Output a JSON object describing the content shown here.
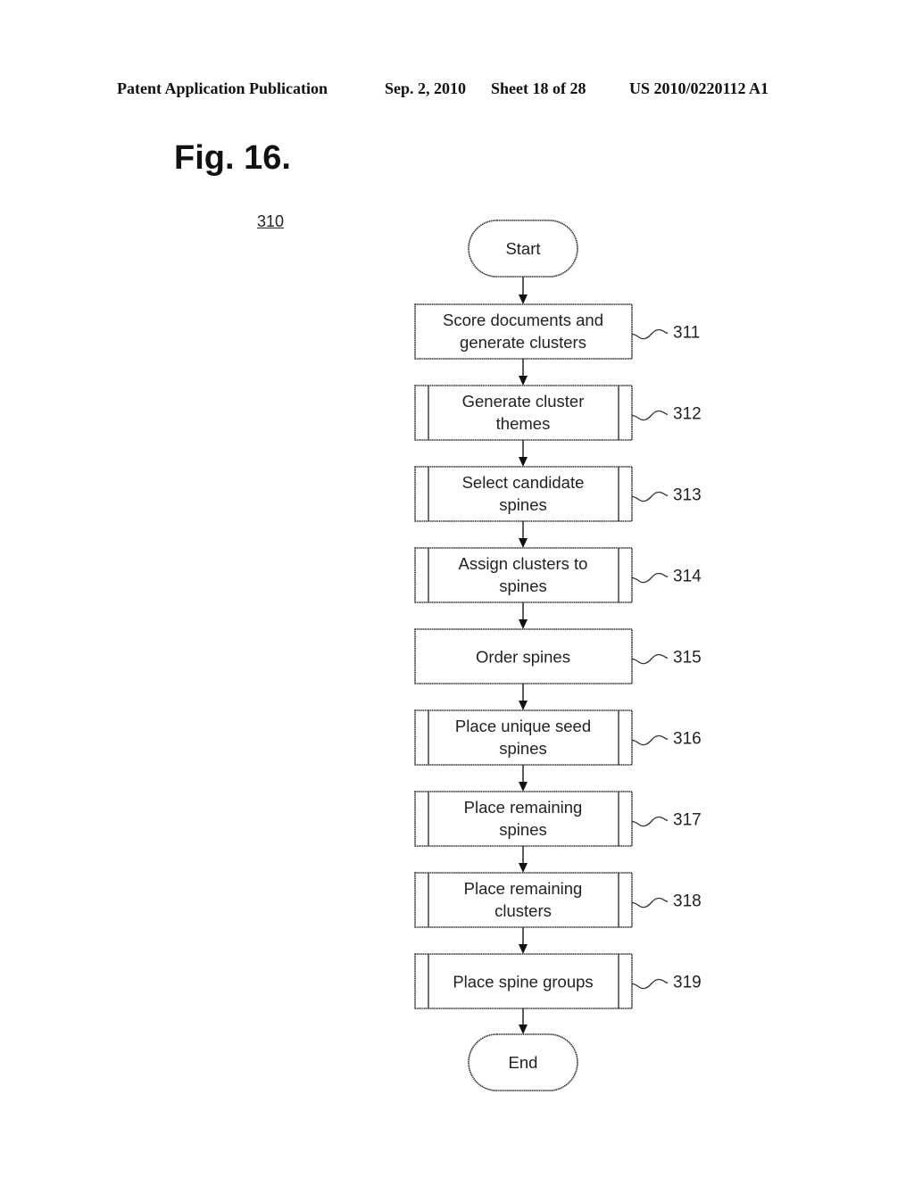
{
  "header": {
    "publication": "Patent Application Publication",
    "date": "Sep. 2, 2010",
    "sheet": "Sheet 18 of 28",
    "number": "US 2010/0220112 A1"
  },
  "figure": {
    "title": "Fig. 16.",
    "reference": "310"
  },
  "flowchart": {
    "start": "Start",
    "end": "End",
    "steps": [
      {
        "ref": "311",
        "lines": [
          "Score documents and",
          "generate clusters"
        ],
        "type": "process"
      },
      {
        "ref": "312",
        "lines": [
          "Generate cluster",
          "themes"
        ],
        "type": "predefined"
      },
      {
        "ref": "313",
        "lines": [
          "Select candidate",
          "spines"
        ],
        "type": "predefined"
      },
      {
        "ref": "314",
        "lines": [
          "Assign clusters to",
          "spines"
        ],
        "type": "predefined"
      },
      {
        "ref": "315",
        "lines": [
          "Order spines"
        ],
        "type": "process"
      },
      {
        "ref": "316",
        "lines": [
          "Place unique seed",
          "spines"
        ],
        "type": "predefined"
      },
      {
        "ref": "317",
        "lines": [
          "Place remaining",
          "spines"
        ],
        "type": "predefined"
      },
      {
        "ref": "318",
        "lines": [
          "Place remaining",
          "clusters"
        ],
        "type": "predefined"
      },
      {
        "ref": "319",
        "lines": [
          "Place spine groups"
        ],
        "type": "predefined"
      }
    ]
  }
}
